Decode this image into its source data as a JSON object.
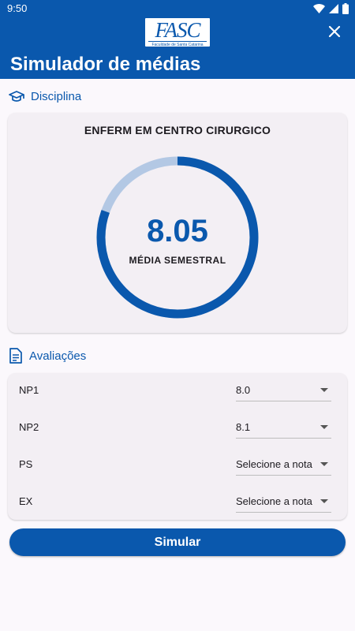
{
  "status_bar": {
    "time": "9:50",
    "icons": [
      "wifi-icon",
      "signal-icon",
      "battery-icon"
    ]
  },
  "app_bar": {
    "logo": {
      "text": "FASC",
      "subtitle": "Faculdade de Santa Catarina"
    },
    "title": "Simulador de médias",
    "close_icon": "close-icon"
  },
  "discipline_section": {
    "icon": "graduation-cap-icon",
    "title": "Disciplina",
    "subject_name": "ENFERM EM CENTRO CIRURGICO",
    "average_value": "8.05",
    "average_label": "MÉDIA SEMESTRAL",
    "progress_fraction": 0.805
  },
  "evaluations_section": {
    "icon": "document-icon",
    "title": "Avaliações",
    "items": [
      {
        "label": "NP1",
        "value": "8.0"
      },
      {
        "label": "NP2",
        "value": "8.1"
      },
      {
        "label": "PS",
        "value": "Selecione a nota"
      },
      {
        "label": "EX",
        "value": "Selecione a nota"
      }
    ]
  },
  "simulate_button": {
    "label": "Simular"
  },
  "colors": {
    "primary": "#0a58ad",
    "ring_track": "#b3c8e4",
    "card_background": "#f3eff4",
    "page_background": "#fbf8fc"
  }
}
